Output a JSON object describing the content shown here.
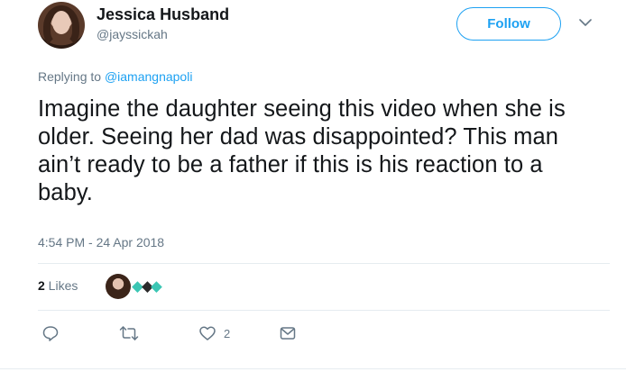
{
  "tweet": {
    "author": {
      "display_name": "Jessica Husband",
      "handle": "@jayssickah"
    },
    "follow_label": "Follow",
    "reply_prefix": "Replying to ",
    "reply_to": "@iamangnapoli",
    "text": "Imagine the daughter seeing this video when she is older. Seeing her dad was disappointed? This man ain’t ready to be a father if this is his reaction to a baby.",
    "timestamp": "4:54 PM - 24 Apr 2018",
    "stats": {
      "likes_count": "2",
      "likes_label": " Likes"
    },
    "actions": {
      "reply_count": "",
      "retweet_count": "",
      "like_count": "2",
      "dm_count": ""
    }
  },
  "colors": {
    "accent": "#1da1f2",
    "text_primary": "#14171a",
    "text_secondary": "#657786",
    "divider": "#e6ecf0"
  },
  "icons": {
    "reply": "reply-icon",
    "retweet": "retweet-icon",
    "like": "heart-icon",
    "dm": "envelope-icon",
    "more": "chevron-down-icon"
  }
}
